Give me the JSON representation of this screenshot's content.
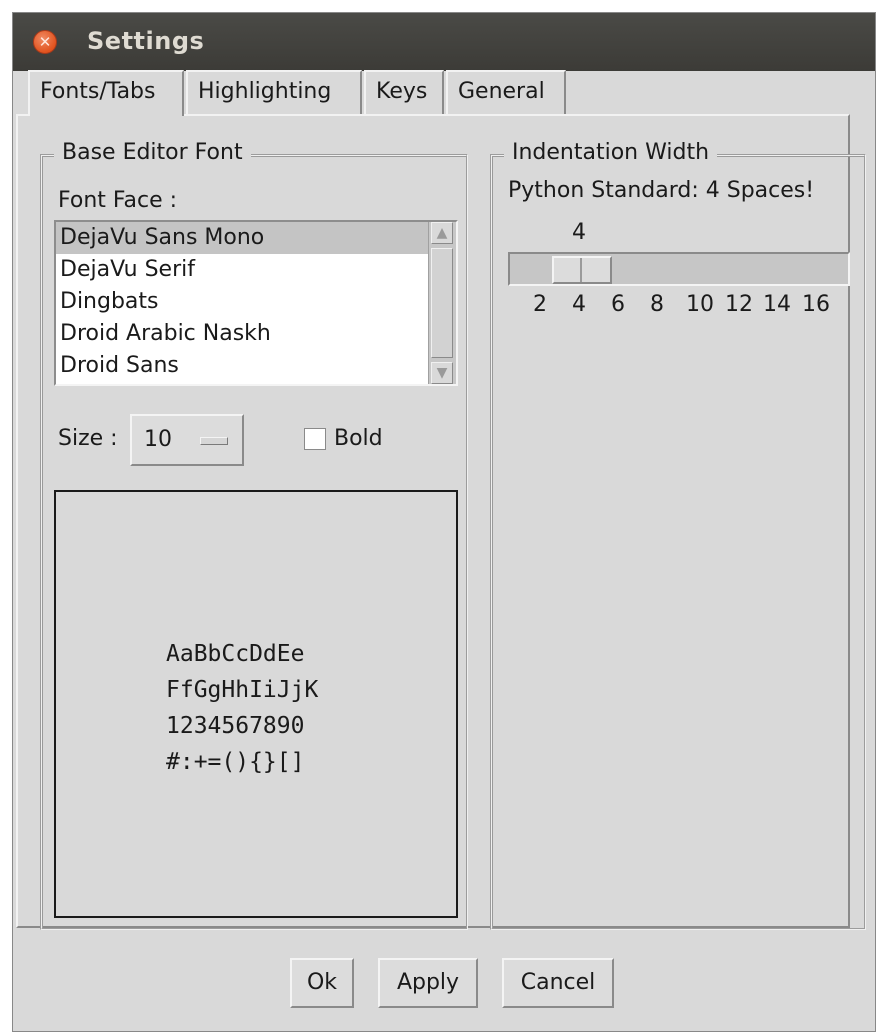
{
  "window": {
    "title": "Settings"
  },
  "tabs": [
    {
      "label": "Fonts/Tabs",
      "active": true
    },
    {
      "label": "Highlighting",
      "active": false
    },
    {
      "label": "Keys",
      "active": false
    },
    {
      "label": "General",
      "active": false
    }
  ],
  "font_group": {
    "title": "Base Editor Font",
    "font_face_label": "Font Face :",
    "fonts": [
      "DejaVu Sans Mono",
      "DejaVu Serif",
      "Dingbats",
      "Droid Arabic Naskh",
      "Droid Sans"
    ],
    "selected_font": "DejaVu Sans Mono",
    "size_label": "Size :",
    "size_value": "10",
    "bold_label": "Bold",
    "bold_checked": false,
    "sample_lines": [
      "AaBbCcDdEe",
      "FfGgHhIiJjK",
      "1234567890",
      "#:+=(){}[]"
    ]
  },
  "indent_group": {
    "title": "Indentation Width",
    "note": "Python Standard: 4 Spaces!",
    "value_label": "4",
    "value": 4,
    "ticks": [
      "2",
      "4",
      "6",
      "8",
      "10",
      "12",
      "14",
      "16"
    ]
  },
  "buttons": {
    "ok": "Ok",
    "apply": "Apply",
    "cancel": "Cancel"
  },
  "colors": {
    "titlebar": "#3c3b37",
    "window_bg": "#d9d9d9",
    "close_button": "#e1531e",
    "selection": "#c4c4c4"
  }
}
